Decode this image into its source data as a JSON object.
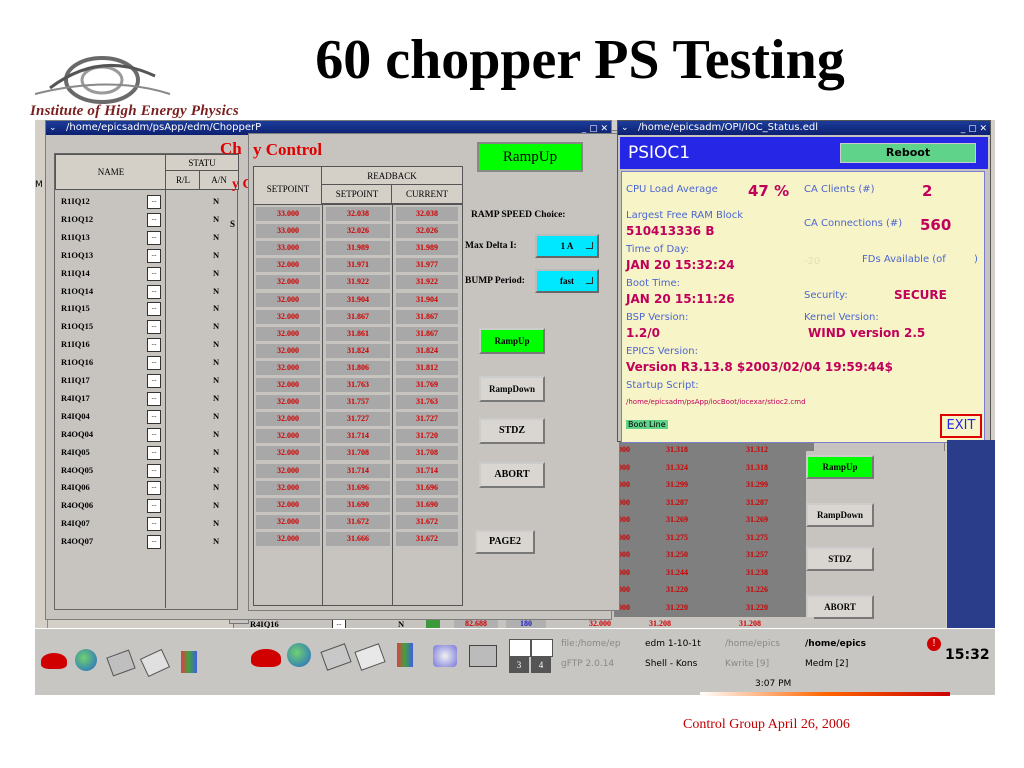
{
  "slide": {
    "title": "60 chopper PS Testing",
    "logo_text": "Institute of High Energy Physics",
    "footer": "Control Group April 26, 2006"
  },
  "chopper_window": {
    "title": "/home/epicsadm/psApp/edm/ChopperP",
    "heading": "Chopper Control",
    "heading_visible": "Ch",
    "heading_visible2": "y Control",
    "ramp_up_top": "RampUp",
    "name_header": "NAME",
    "status_header": "STATU",
    "rl_header": "R/L",
    "an_header": "A/N",
    "setpoint_header": "SETPOINT",
    "readback_header": "READBACK",
    "rb_setpoint_header": "SETPOINT",
    "rb_current_header": "CURRENT",
    "ramp_speed_label": "RAMP SPEED Choice:",
    "max_delta_label": "Max Delta I:",
    "max_delta_value": "1 A",
    "bump_label": "BUMP Period:",
    "bump_value": "fast",
    "buttons": [
      "RampUp",
      "RampDown",
      "STDZ",
      "ABORT",
      "PAGE2"
    ],
    "rows": [
      {
        "name": "R1IQ12",
        "an": "N",
        "sp": "33.000",
        "rsp": "32.038",
        "cur": "32.038"
      },
      {
        "name": "R1OQ12",
        "an": "N",
        "sp": "33.000",
        "rsp": "32.026",
        "cur": "32.026"
      },
      {
        "name": "R1IQ13",
        "an": "N",
        "sp": "33.000",
        "rsp": "31.989",
        "cur": "31.989"
      },
      {
        "name": "R1OQ13",
        "an": "N",
        "sp": "32.000",
        "rsp": "31.971",
        "cur": "31.977"
      },
      {
        "name": "R1IQ14",
        "an": "N",
        "sp": "32.000",
        "rsp": "31.922",
        "cur": "31.922"
      },
      {
        "name": "R1OQ14",
        "an": "N",
        "sp": "32.000",
        "rsp": "31.904",
        "cur": "31.904"
      },
      {
        "name": "R1IQ15",
        "an": "N",
        "sp": "32.000",
        "rsp": "31.867",
        "cur": "31.867"
      },
      {
        "name": "R1OQ15",
        "an": "N",
        "sp": "32.000",
        "rsp": "31.861",
        "cur": "31.867"
      },
      {
        "name": "R1IQ16",
        "an": "N",
        "sp": "32.000",
        "rsp": "31.824",
        "cur": "31.824"
      },
      {
        "name": "R1OQ16",
        "an": "N",
        "sp": "32.000",
        "rsp": "31.806",
        "cur": "31.812"
      },
      {
        "name": "R1IQ17",
        "an": "N",
        "sp": "32.000",
        "rsp": "31.763",
        "cur": "31.769"
      },
      {
        "name": "R4IQ17",
        "an": "N",
        "sp": "32.000",
        "rsp": "31.757",
        "cur": "31.763"
      },
      {
        "name": "R4IQ04",
        "an": "N",
        "sp": "32.000",
        "rsp": "31.727",
        "cur": "31.727"
      },
      {
        "name": "R4OQ04",
        "an": "N",
        "sp": "32.000",
        "rsp": "31.714",
        "cur": "31.720"
      },
      {
        "name": "R4IQ05",
        "an": "N",
        "sp": "32.000",
        "rsp": "31.708",
        "cur": "31.708"
      },
      {
        "name": "R4OQ05",
        "an": "N",
        "sp": "32.000",
        "rsp": "31.714",
        "cur": "31.714"
      },
      {
        "name": "R4IQ06",
        "an": "N",
        "sp": "32.000",
        "rsp": "31.696",
        "cur": "31.696"
      },
      {
        "name": "R4OQ06",
        "an": "N",
        "sp": "32.000",
        "rsp": "31.690",
        "cur": "31.690"
      },
      {
        "name": "R4IQ07",
        "an": "N",
        "sp": "32.000",
        "rsp": "31.672",
        "cur": "31.672"
      },
      {
        "name": "R4OQ07",
        "an": "N",
        "sp": "32.000",
        "rsp": "31.666",
        "cur": "31.672"
      }
    ]
  },
  "back_window": {
    "rows": [
      {
        "sp": "000",
        "rsp": "31.318",
        "cur": "31.312"
      },
      {
        "sp": "000",
        "rsp": "31.324",
        "cur": "31.318"
      },
      {
        "sp": "000",
        "rsp": "31.299",
        "cur": "31.299"
      },
      {
        "sp": "000",
        "rsp": "31.287",
        "cur": "31.287"
      },
      {
        "sp": "000",
        "rsp": "31.269",
        "cur": "31.269"
      },
      {
        "sp": "000",
        "rsp": "31.275",
        "cur": "31.275"
      },
      {
        "sp": "000",
        "rsp": "31.250",
        "cur": "31.257"
      },
      {
        "sp": "000",
        "rsp": "31.244",
        "cur": "31.238"
      },
      {
        "sp": "000",
        "rsp": "31.220",
        "cur": "31.226"
      },
      {
        "sp": "000",
        "rsp": "31.220",
        "cur": "31.220"
      }
    ],
    "last_row": {
      "name": "R4IQ16",
      "an": "N",
      "v1": "82.688",
      "v2": "180",
      "sp": "32.000",
      "rsp": "31.208",
      "cur": "31.208"
    },
    "buttons": [
      "RampUp",
      "RampDown",
      "STDZ",
      "ABORT"
    ]
  },
  "psioc_window": {
    "title": "/home/epicsadm/OPI/IOC_Status.edl",
    "name": "PSIOC1",
    "reboot": "Reboot",
    "cpu_label": "CPU Load Average",
    "cpu_value": "47 %",
    "ca_clients_label": "CA Clients (#)",
    "ca_clients_value": "2",
    "ram_label": "Largest Free RAM Block",
    "ram_value": "510413336 B",
    "ca_conn_label": "CA Connections (#)",
    "ca_conn_value": "560",
    "time_label": "Time of Day:",
    "time_value": "JAN 20 15:32:24",
    "fds_value": "-20",
    "fds_label": "FDs Available (of",
    "fds_tail": ")",
    "boot_label": "Boot Time:",
    "boot_value": "JAN 20 15:11:26",
    "security_label": "Security:",
    "security_value": "SECURE",
    "bsp_label": "BSP Version:",
    "bsp_value": "1.2/0",
    "kernel_label": "Kernel Version:",
    "kernel_value": "WIND version 2.5",
    "epics_label": "EPICS Version:",
    "epics_value": "Version R3.13.8 $2003/02/04 19:59:44$",
    "startup_label": "Startup Script:",
    "startup_value": "/home/epicsadm/psApp/iocBoot/iocexar/stioc2.cmd",
    "boot_line": "Boot Line",
    "exit": "EXIT"
  },
  "taskbar": {
    "pager": [
      "3",
      "4"
    ],
    "tasks_top": [
      "file:/home/ep",
      "edm 1-10-1t",
      "/home/epics",
      "/home/epics"
    ],
    "tasks_bottom": [
      "gFTP 2.0.14",
      "Shell - Kons",
      "Kwrite [9]",
      "Medm [2]"
    ],
    "clock": "15:32",
    "clock2": "3:07 PM"
  },
  "colors": {
    "accent_green": "#00ff00",
    "psioc_blue": "#2626e6",
    "value_red": "#d00000",
    "titlebar": "#0c2070"
  }
}
